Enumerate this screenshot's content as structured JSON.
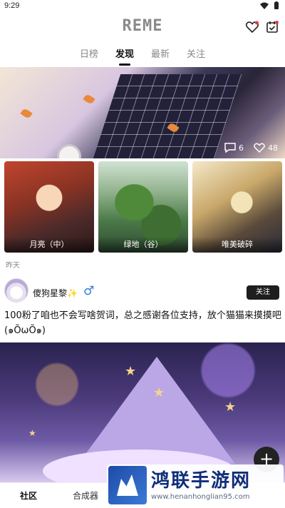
{
  "status_bar": {
    "time": "9:29"
  },
  "header": {
    "logo": "REME"
  },
  "tabs": [
    {
      "label": "日榜"
    },
    {
      "label": "发现"
    },
    {
      "label": "最新"
    },
    {
      "label": "关注"
    }
  ],
  "hero": {
    "comments": "6",
    "likes": "48"
  },
  "thumbnails": [
    {
      "caption": "月亮（中）"
    },
    {
      "caption": "绿地（谷）"
    },
    {
      "caption": "唯美破碎"
    }
  ],
  "section_label": "昨天",
  "post": {
    "username": "傻狗星黎✨",
    "gender_symbol": "♂",
    "follow_label": "关注",
    "text": "100粉了咱也不会写啥贺词，总之感谢各位支持，放个猫猫来摸摸吧(๑ÕωÕ๑)"
  },
  "bottom_nav": [
    {
      "label": "社区"
    },
    {
      "label": "合成器"
    }
  ],
  "watermark": {
    "title": "鸿联手游网",
    "url": "www.henanhonglian95.com"
  }
}
